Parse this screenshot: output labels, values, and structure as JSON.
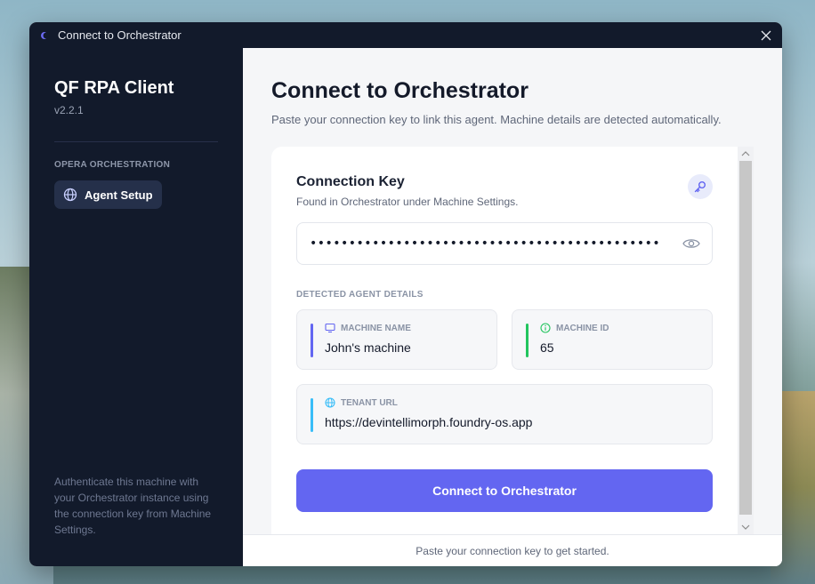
{
  "window": {
    "title": "Connect to Orchestrator"
  },
  "sidebar": {
    "app_name": "QF RPA Client",
    "version": "v2.2.1",
    "section_label": "OPERA ORCHESTRATION",
    "items": [
      {
        "label": "Agent Setup",
        "icon": "globe-icon"
      }
    ],
    "footer_text": "Authenticate this machine with your Orchestrator instance using the connection key from Machine Settings."
  },
  "main": {
    "title": "Connect to Orchestrator",
    "subtitle": "Paste your connection key to link this agent. Machine details are detected automatically.",
    "connection_key": {
      "title": "Connection Key",
      "subtitle": "Found in Orchestrator under Machine Settings.",
      "masked_value": "•••••••••••••••••••••••••••••••••••••••••••••"
    },
    "details": {
      "label": "DETECTED AGENT DETAILS",
      "machine_name": {
        "label": "MACHINE NAME",
        "value": "John's machine",
        "color": "#6366f1"
      },
      "machine_id": {
        "label": "MACHINE ID",
        "value": "65",
        "color": "#22c55e"
      },
      "tenant_url": {
        "label": "TENANT URL",
        "value": "https://devintellimorph.foundry-os.app",
        "color": "#38bdf8"
      }
    },
    "connect_button": "Connect to Orchestrator",
    "status": "Paste your connection key to get started."
  },
  "colors": {
    "accent": "#6366f1",
    "sidebar_bg": "#121a2b"
  }
}
